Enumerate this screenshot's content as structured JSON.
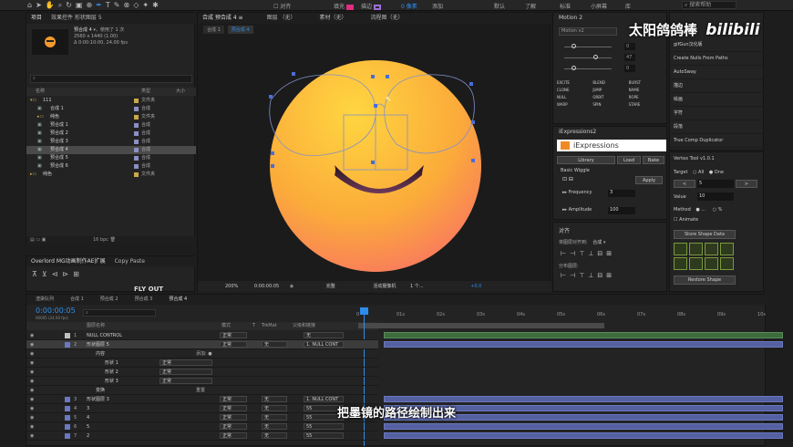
{
  "toolbar": {
    "align_label": "对齐",
    "default_label": "默认",
    "learn_label": "了解",
    "standard_label": "标准",
    "small_screen_label": "小屏幕",
    "library_label": "库",
    "search_placeholder": "搜索帮助",
    "workspace_icons": [
      "home-icon",
      "selection-tool-icon",
      "hand-tool-icon",
      "zoom-tool-icon",
      "rotate-tool-icon",
      "camera-tool-icon",
      "pan-behind-tool-icon",
      "pen-tool-icon",
      "type-tool-icon",
      "brush-tool-icon",
      "clone-stamp-tool-icon",
      "eraser-tool-icon",
      "roto-brush-tool-icon",
      "puppet-tool-icon"
    ],
    "fill_label": "填充",
    "stroke_label": "描边",
    "stroke_px": "0 像素",
    "add_label": "添加"
  },
  "project": {
    "tab_label": "项目",
    "fx_label": "效果控件 形状图层 5",
    "comp_name": "预合成 4",
    "used_count": "，使用了 1 次",
    "dimensions": "2560 x 1440 (1.00)",
    "duration": "Δ 0:00:10:00, 24.00 fps",
    "search_placeholder": "",
    "col_name": "名称",
    "col_type": "类型",
    "col_size": "大小",
    "items": [
      {
        "name": "111",
        "type": "文件夹",
        "indent": 0,
        "kind": "folder",
        "expanded": true
      },
      {
        "name": "合成 1",
        "type": "合成",
        "indent": 1,
        "kind": "comp"
      },
      {
        "name": "纯色",
        "type": "文件夹",
        "indent": 1,
        "kind": "folder"
      },
      {
        "name": "预合成 1",
        "type": "合成",
        "indent": 1,
        "kind": "comp"
      },
      {
        "name": "预合成 2",
        "type": "合成",
        "indent": 1,
        "kind": "comp"
      },
      {
        "name": "预合成 3",
        "type": "合成",
        "indent": 1,
        "kind": "comp"
      },
      {
        "name": "预合成 4",
        "type": "合成",
        "indent": 1,
        "kind": "comp",
        "selected": true
      },
      {
        "name": "预合成 5",
        "type": "合成",
        "indent": 1,
        "kind": "comp"
      },
      {
        "name": "预合成 6",
        "type": "合成",
        "indent": 1,
        "kind": "comp"
      },
      {
        "name": "纯色",
        "type": "文件夹",
        "indent": 0,
        "kind": "folder"
      }
    ],
    "bpc": "16 bpc"
  },
  "overlord": {
    "tab_label": "Overlord  MG动画制作AE扩展",
    "paste_label": "Copy Paste",
    "brand": "FLY OUT"
  },
  "viewer": {
    "comp_tab": "合成 预合成 4",
    "layer_tab": "图层 （无）",
    "footage_tab": "素材（无）",
    "flow_tab": "流程图（无）",
    "subtabs": [
      "合成 1",
      "预合成 4"
    ],
    "zoom": "200%",
    "timecode": "0:00:00:05",
    "quality": "完整",
    "camera": "活动摄像机",
    "views": "1 个...",
    "exposure": "+0.0"
  },
  "motion": {
    "title": "Motion 2",
    "version": "Motion v2",
    "values": [
      "0",
      "47",
      "0"
    ],
    "buttons": [
      "EXCITE",
      "BLEND",
      "BURST",
      "CLONE",
      "JUMP",
      "NAME",
      "NULL",
      "ORBIT",
      "ROPE",
      "WARP",
      "SPIN",
      "STARE"
    ]
  },
  "iexp": {
    "title": "iExpressions2",
    "logo_text": "iExpressions",
    "library": "Library",
    "load": "Load",
    "bake": "Bake",
    "preset": "Basic Wiggle",
    "apply": "Apply",
    "frequency_label": "Frequency",
    "frequency": "3",
    "amplitude_label": "Amplitude",
    "amplitude": "100"
  },
  "align": {
    "title": "对齐",
    "align_to_label": "将图层对齐到:",
    "align_to": "合成",
    "distribute_label": "分布图层:"
  },
  "scripts": {
    "items": [
      "gifGun汉化版",
      "Create Nulls From Paths",
      "AutoSway",
      "描边",
      "绘画",
      "字符",
      "段落",
      "True Comp Duplicator"
    ]
  },
  "vertex": {
    "title": "Vertex Tool v1.0.1",
    "target_label": "Target",
    "opt_all": "All",
    "opt_one": "One",
    "value_stepper": "5",
    "value_label": "Value",
    "value": "10",
    "method_label": "Method",
    "method_opt1": "...",
    "method_opt2": "%",
    "animate_label": "Animate",
    "store": "Store Shape Data",
    "restore": "Restore Shape"
  },
  "watermark": {
    "text": "太阳鸽鸽棒",
    "brand": "bilibili"
  },
  "timeline": {
    "tabs": [
      "渲染队列",
      "合成 1",
      "预合成 2",
      "预合成 3",
      "预合成 4"
    ],
    "timecode": "0:00:00:05",
    "frame_info": "00005 (24.00 fps)",
    "headers": {
      "source": "图层名称",
      "mode": "模式",
      "t": "T",
      "trkmat": "TrkMat",
      "parent": "父级和链接"
    },
    "ruler": [
      "0",
      "01s",
      "02s",
      "03s",
      "04s",
      "05s",
      "06s",
      "07s",
      "08s",
      "09s",
      "10s"
    ],
    "layers": [
      {
        "num": "1",
        "name": "NULL CONTROL",
        "color": "#c0c0c0",
        "mode": "正常",
        "trk": "",
        "parent": "无",
        "indent": 0,
        "bar": "green"
      },
      {
        "num": "2",
        "name": "形状图层 5",
        "color": "#6a78c0",
        "mode": "正常",
        "trk": "无",
        "parent": "1. NULL CONT",
        "indent": 0,
        "bar": "blue",
        "selected": true
      },
      {
        "num": "",
        "name": "内容",
        "color": "",
        "mode": "",
        "trk": "",
        "parent": "",
        "indent": 1,
        "bar": "none",
        "extra": "添加: ●"
      },
      {
        "num": "",
        "name": "形状 1",
        "color": "",
        "mode": "正常",
        "trk": "",
        "parent": "",
        "indent": 2,
        "bar": "none"
      },
      {
        "num": "",
        "name": "形状 2",
        "color": "",
        "mode": "正常",
        "trk": "",
        "parent": "",
        "indent": 2,
        "bar": "none"
      },
      {
        "num": "",
        "name": "形状 3",
        "color": "",
        "mode": "正常",
        "trk": "",
        "parent": "",
        "indent": 2,
        "bar": "none"
      },
      {
        "num": "",
        "name": "变换",
        "color": "",
        "mode": "",
        "trk": "",
        "parent": "",
        "indent": 1,
        "bar": "none",
        "extra": "重置"
      },
      {
        "num": "3",
        "name": "形状图层 3",
        "color": "#6a78c0",
        "mode": "正常",
        "trk": "无",
        "parent": "1. NULL CONT",
        "indent": 0,
        "bar": "blue"
      },
      {
        "num": "4",
        "name": "3",
        "color": "#6a78c0",
        "mode": "正常",
        "trk": "无",
        "parent": "55",
        "indent": 0,
        "bar": "blue"
      },
      {
        "num": "5",
        "name": "4",
        "color": "#6a78c0",
        "mode": "正常",
        "trk": "无",
        "parent": "55",
        "indent": 0,
        "bar": "blue"
      },
      {
        "num": "6",
        "name": "5",
        "color": "#6a78c0",
        "mode": "正常",
        "trk": "无",
        "parent": "55",
        "indent": 0,
        "bar": "blue"
      },
      {
        "num": "7",
        "name": "2",
        "color": "#6a78c0",
        "mode": "正常",
        "trk": "无",
        "parent": "55",
        "indent": 0,
        "bar": "blue"
      }
    ]
  },
  "subtitle": "把墨镜的路径绘制出来"
}
